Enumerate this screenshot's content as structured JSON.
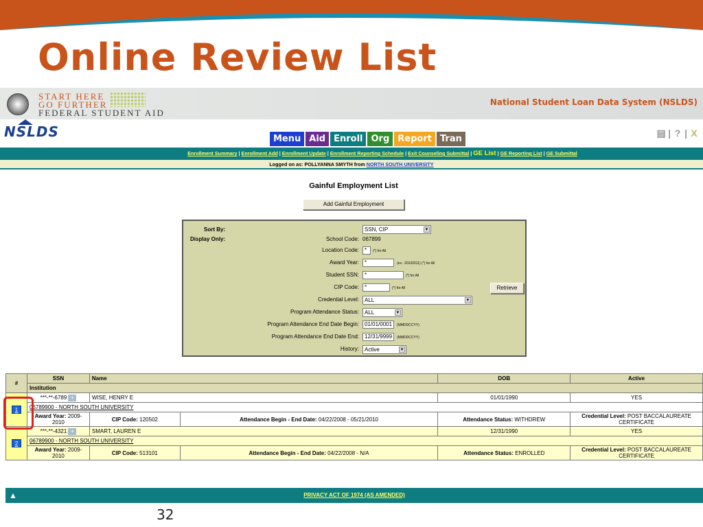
{
  "slide": {
    "title": "Online Review List",
    "number": "32"
  },
  "fsa_header": {
    "line1": "START HERE",
    "line2": "GO FURTHER",
    "line3": "FEDERAL STUDENT AID",
    "system_name": "National Student Loan Data System (NSLDS)"
  },
  "logo": {
    "text": "NSLDS"
  },
  "nav": {
    "buttons": [
      {
        "label": "Menu",
        "color": "#1d3fd0"
      },
      {
        "label": "Aid",
        "color": "#6b2c91"
      },
      {
        "label": "Enroll",
        "color": "#0e7d82"
      },
      {
        "label": "Org",
        "color": "#2f8f2f"
      },
      {
        "label": "Report",
        "color": "#f5a623"
      },
      {
        "label": "Tran",
        "color": "#7a6a5a"
      }
    ],
    "icons": [
      "printer-icon",
      "help-icon",
      "close-icon"
    ]
  },
  "links": {
    "items": [
      "Enrollment Summary",
      "Enrollment Add",
      "Enrollment Update",
      "Enrollment Reporting Schedule",
      "Exit Counseling Submittal",
      "GE List",
      "GE Reporting List",
      "GE Submittal"
    ],
    "current": "GE List"
  },
  "logged_in": {
    "prefix": "Logged on as: POLLYANNA SMYTH from ",
    "school": "NORTH SOUTH UNIVERSITY"
  },
  "page": {
    "heading": "Gainful Employment List",
    "add_button": "Add Gainful Employment"
  },
  "filters": {
    "sort_by_label": "Sort By:",
    "display_only_label": "Display Only:",
    "sort_by_value": "SSN, CIP",
    "school_code_label": "School Code:",
    "school_code_value": "067899",
    "location_code_label": "Location Code:",
    "location_code_value": "*",
    "location_code_hint": "(*) for All",
    "award_year_label": "Award Year:",
    "award_year_value": "*",
    "award_year_hint": "(ex.: 20102011) (*) for All",
    "student_ssn_label": "Student SSN:",
    "student_ssn_value": "*",
    "student_ssn_hint": "(*) for All",
    "cip_code_label": "CIP Code:",
    "cip_code_value": "*",
    "cip_code_hint": "(*) for All",
    "credential_level_label": "Credential Level:",
    "credential_level_value": "ALL",
    "program_attendance_status_label": "Program Attendance Status:",
    "program_attendance_status_value": "ALL",
    "end_date_begin_label": "Program Attendance End Date Begin:",
    "end_date_begin_value": "01/01/0001",
    "end_date_begin_hint": "(MMDDCCYY)",
    "end_date_end_label": "Program Attendance End Date End:",
    "end_date_end_value": "12/31/9999",
    "end_date_end_hint": "(MMDDCCYY)",
    "history_label": "History:",
    "history_value": "Active",
    "retrieve_button": "Retrieve"
  },
  "table": {
    "headers": {
      "num": "#",
      "ssn": "SSN",
      "name": "Name",
      "dob": "DOB",
      "active": "Active",
      "institution": "Institution"
    },
    "rows": [
      {
        "num": "1",
        "ssn": "***-**-6789",
        "name": "WISE, HENRY E",
        "dob": "01/01/1990",
        "active": "YES",
        "institution": "06789900 - NORTH SOUTH UNIVERSITY",
        "award_year_label": "Award Year:",
        "award_year": "2009-2010",
        "cip_label": "CIP Code:",
        "cip": "120502",
        "attendance_dates_label": "Attendance Begin - End Date:",
        "attendance_dates": "04/22/2008 - 05/21/2010",
        "attendance_status_label": "Attendance Status:",
        "attendance_status": "WITHDREW",
        "credential_label": "Credential Level:",
        "credential": "POST BACCALAUREATE CERTIFICATE"
      },
      {
        "num": "2",
        "ssn": "***-**-4321",
        "name": "SMART, LAUREN E",
        "dob": "12/31/1990",
        "active": "YES",
        "institution": "06789900 - NORTH SOUTH UNIVERSITY",
        "award_year_label": "Award Year:",
        "award_year": "2009-2010",
        "cip_label": "CIP Code:",
        "cip": "513101",
        "attendance_dates_label": "Attendance Begin - End Date:",
        "attendance_dates": "04/22/2008 - N/A",
        "attendance_status_label": "Attendance Status:",
        "attendance_status": "ENROLLED",
        "credential_label": "Credential Level:",
        "credential": "POST BACCALAUREATE CERTIFICATE"
      }
    ]
  },
  "footer": {
    "privacy_link": "PRIVACY ACT OF 1974 (AS AMENDED)"
  },
  "colors": {
    "accent_orange": "#c9541b",
    "teal": "#0e7d82",
    "panel": "#d6d7a9",
    "highlight": "#e0201b"
  }
}
